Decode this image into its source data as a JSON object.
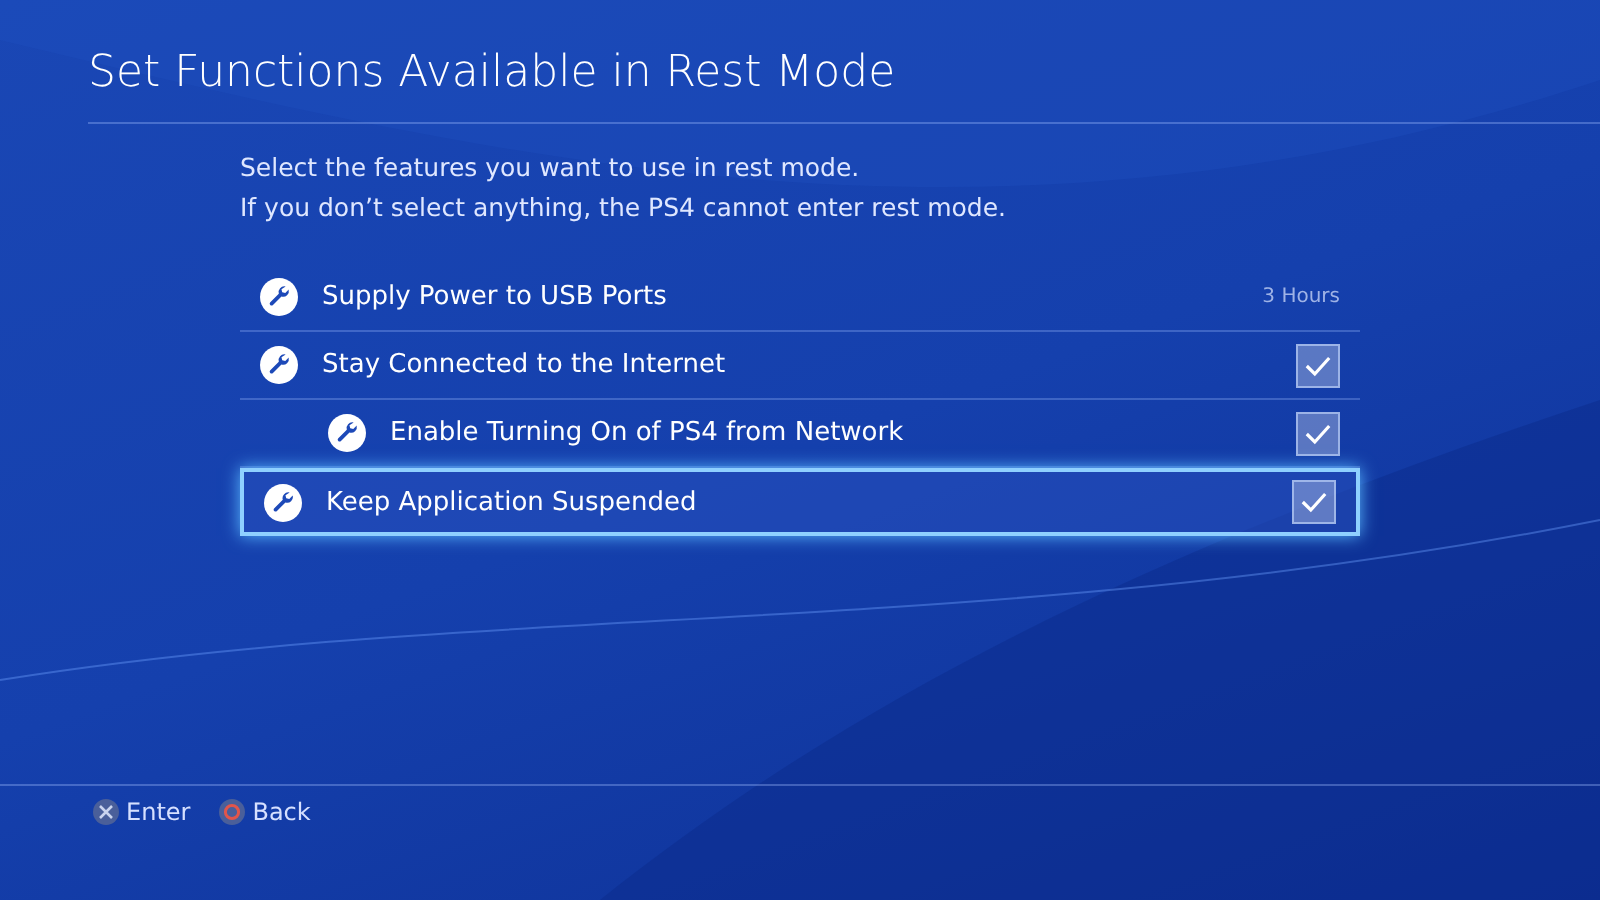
{
  "title": "Set Functions Available in Rest Mode",
  "description": [
    "Select the features you want to use in rest mode.",
    "If you don’t select anything, the PS4 cannot enter rest mode."
  ],
  "items": [
    {
      "kind": "value",
      "label": "Supply Power to USB Ports",
      "value": "3 Hours",
      "selected": false
    },
    {
      "kind": "checkbox",
      "label": "Stay Connected to the Internet",
      "checked": true,
      "selected": false,
      "children": [
        {
          "kind": "checkbox",
          "label": "Enable Turning On of PS4 from Network",
          "checked": true,
          "selected": false
        }
      ]
    },
    {
      "kind": "checkbox",
      "label": "Keep Application Suspended",
      "checked": true,
      "selected": true
    }
  ],
  "footer": [
    {
      "kind": "cross",
      "label": "Enter"
    },
    {
      "kind": "circle",
      "label": "Back"
    }
  ]
}
